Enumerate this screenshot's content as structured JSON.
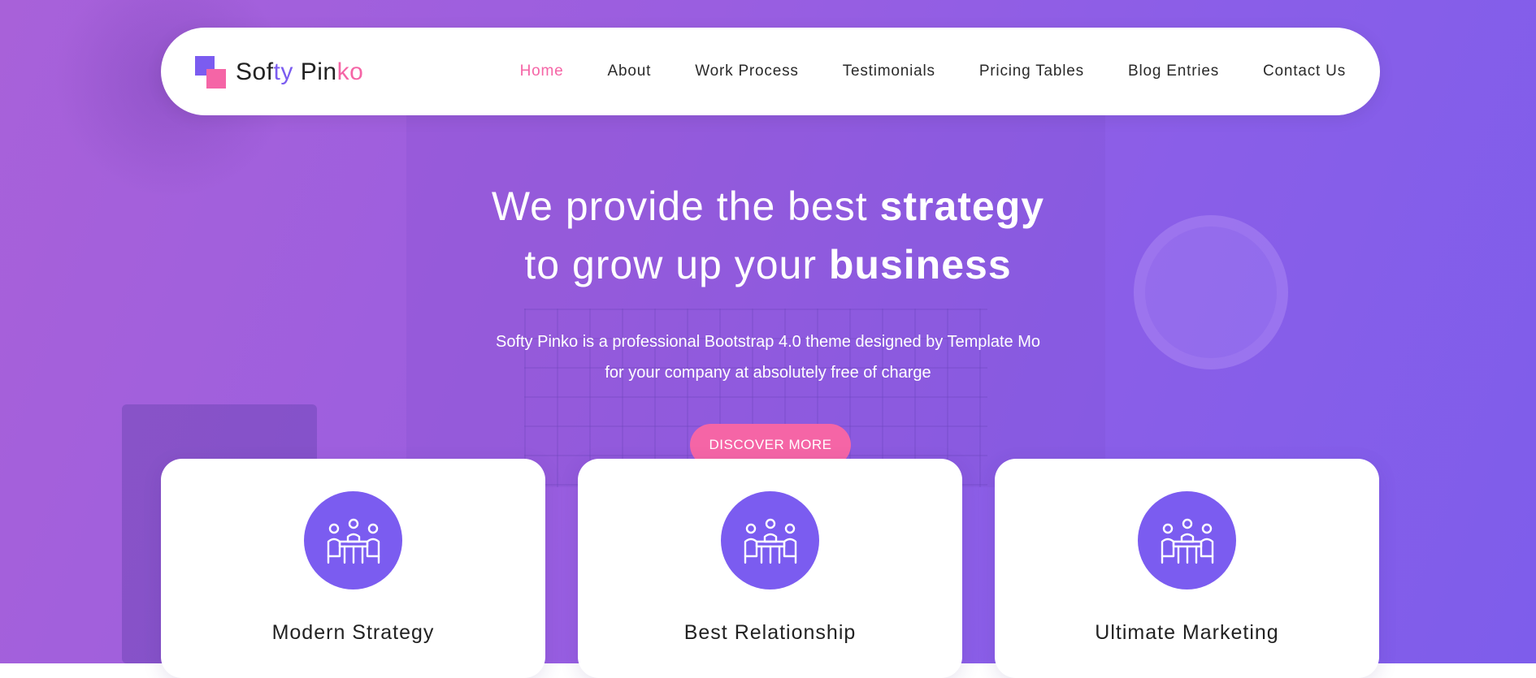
{
  "brand": {
    "logo_part1": "Sof",
    "logo_part2": "ty",
    "logo_part3": " Pin",
    "logo_part4": "ko"
  },
  "nav": {
    "items": [
      {
        "label": "Home",
        "active": true
      },
      {
        "label": "About"
      },
      {
        "label": "Work Process"
      },
      {
        "label": "Testimonials"
      },
      {
        "label": "Pricing Tables"
      },
      {
        "label": "Blog Entries"
      },
      {
        "label": "Contact Us"
      }
    ]
  },
  "hero": {
    "headline_line1_normal": "We provide the best ",
    "headline_line1_bold": "strategy",
    "headline_line2_normal": "to grow up your ",
    "headline_line2_bold": "business",
    "sub_line1": "Softy Pinko is a professional Bootstrap 4.0 theme designed by Template Mo",
    "sub_line2": "for your company at absolutely free of charge",
    "cta_label": "DISCOVER MORE"
  },
  "features": [
    {
      "title": "Modern Strategy",
      "icon": "meeting-icon"
    },
    {
      "title": "Best Relationship",
      "icon": "meeting-icon"
    },
    {
      "title": "Ultimate Marketing",
      "icon": "meeting-icon"
    }
  ],
  "colors": {
    "accent_pink": "#f565a6",
    "accent_purple": "#7b5cf0",
    "hero_gradient_start": "#a861d9",
    "hero_gradient_end": "#7e5deb"
  }
}
